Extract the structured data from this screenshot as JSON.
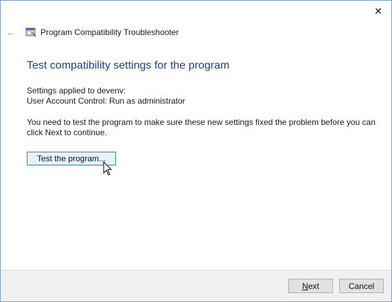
{
  "window": {
    "title": "Program Compatibility Troubleshooter",
    "close_glyph": "✕",
    "back_glyph": "←",
    "icons": {
      "back": "back-arrow-icon",
      "app": "troubleshooter-app-icon",
      "close": "close-icon"
    }
  },
  "main": {
    "heading": "Test compatibility settings for the program",
    "settings_line1": "Settings applied to devenv:",
    "settings_line2": "User Account Control:  Run as administrator",
    "info_text": "You need to test the program to make sure these new settings fixed the problem before you can click Next to continue.",
    "test_button_label": "Test the program..."
  },
  "footer": {
    "next_label_underlined": "N",
    "next_label_rest": "ext",
    "cancel_label": "Cancel"
  },
  "colors": {
    "heading": "#1f3f8f",
    "test_button_bg": "#e5f1fb",
    "test_button_border": "#3c7fb1",
    "footer_bg": "#f0f0f0"
  }
}
